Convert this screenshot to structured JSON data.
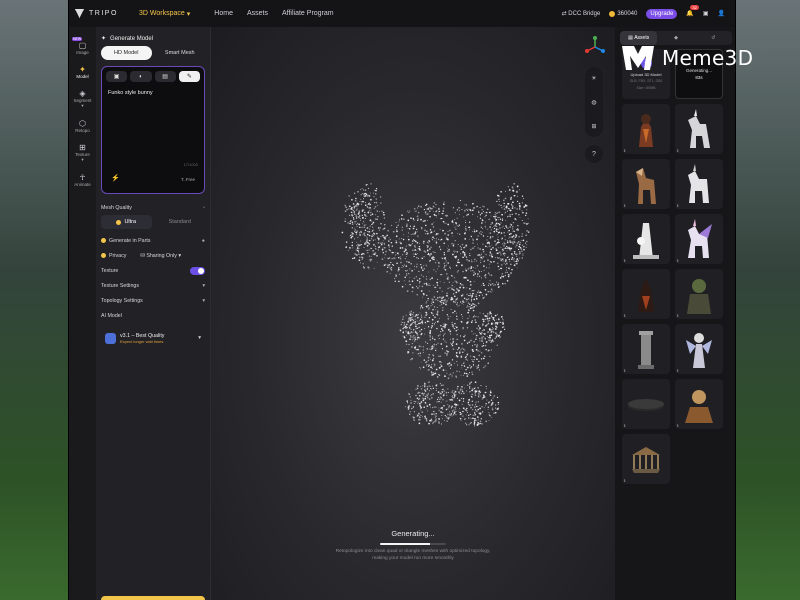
{
  "header": {
    "brand": "TRIPO",
    "workspace": "3D Workspace",
    "nav": [
      "Home",
      "Assets",
      "Affiliate Program"
    ],
    "dcc_bridge": "DCC Bridge",
    "credits": "360040",
    "upgrade": "Upgrade",
    "notification_count": "32"
  },
  "rail": {
    "items": [
      {
        "label": "Image",
        "tag": "NEW"
      },
      {
        "label": "Model"
      },
      {
        "label": "Segment"
      },
      {
        "label": "Retopo"
      },
      {
        "label": "Texture"
      },
      {
        "label": "Animate"
      }
    ]
  },
  "panel": {
    "title": "Generate Model",
    "mode_tabs": [
      "HD Model",
      "Smart Mesh"
    ],
    "prompt": "Funko style bunny",
    "prompt_counter": "17/1000",
    "free_label": "T..Free",
    "mesh_quality_label": "Mesh Quality",
    "quality_options": [
      "Ultra",
      "Standard"
    ],
    "generate_in_parts": "Generate in Parts",
    "privacy": "Privacy",
    "sharing": "Sharing Only",
    "texture": "Texture",
    "texture_settings": "Texture Settings",
    "topology_settings": "Topology Settings",
    "ai_model_label": "AI Model",
    "model_name": "v3.1 – Best Quality",
    "model_sub": "Expect longer wait times"
  },
  "viewport": {
    "status": "Generating...",
    "progress": 0.75,
    "desc_line1": "Retopologize into clean quad or triangle meshes with optimized topology,",
    "desc_line2": "making your model run more smoothly"
  },
  "assets": {
    "tabs": [
      "Assets",
      "",
      ""
    ],
    "upload_title": "Upload 3D Model",
    "upload_sub1": "GLB, FBX, STL, OBJ",
    "upload_sub2": "Size <50MB",
    "generating_label": "Generating...",
    "generating_time": "83s"
  },
  "watermark": "Meme3D",
  "colors": {
    "accent": "#f3c64a",
    "purple": "#6b4fe6",
    "app_bg": "#1b1b1f"
  }
}
